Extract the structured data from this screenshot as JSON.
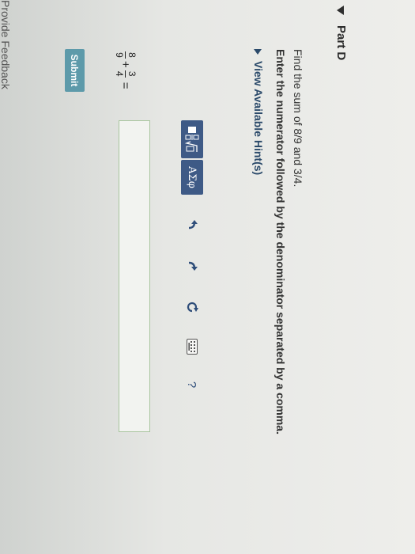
{
  "part": {
    "title": "Part D"
  },
  "question": {
    "line1": "Find the sum of 8/9 and 3/4.",
    "line2": "Enter the numerator followed by the denominator separated by a comma."
  },
  "hint": {
    "label": "View Available Hint(s)"
  },
  "expression": {
    "frac1": {
      "num": "8",
      "den": "9"
    },
    "plus": "+",
    "frac2": {
      "num": "3",
      "den": "4"
    },
    "equals": "="
  },
  "toolbar": {
    "templates_icon": "fraction-sqrt-template-icon",
    "symbols_label": "ΑΣφ",
    "undo_icon": "undo-icon",
    "redo_icon": "redo-icon",
    "reset_icon": "reset-icon",
    "keyboard_icon": "keyboard-icon",
    "help_label": "?"
  },
  "submit": {
    "label": "Submit"
  },
  "feedback": {
    "label": "Provide Feedback"
  }
}
